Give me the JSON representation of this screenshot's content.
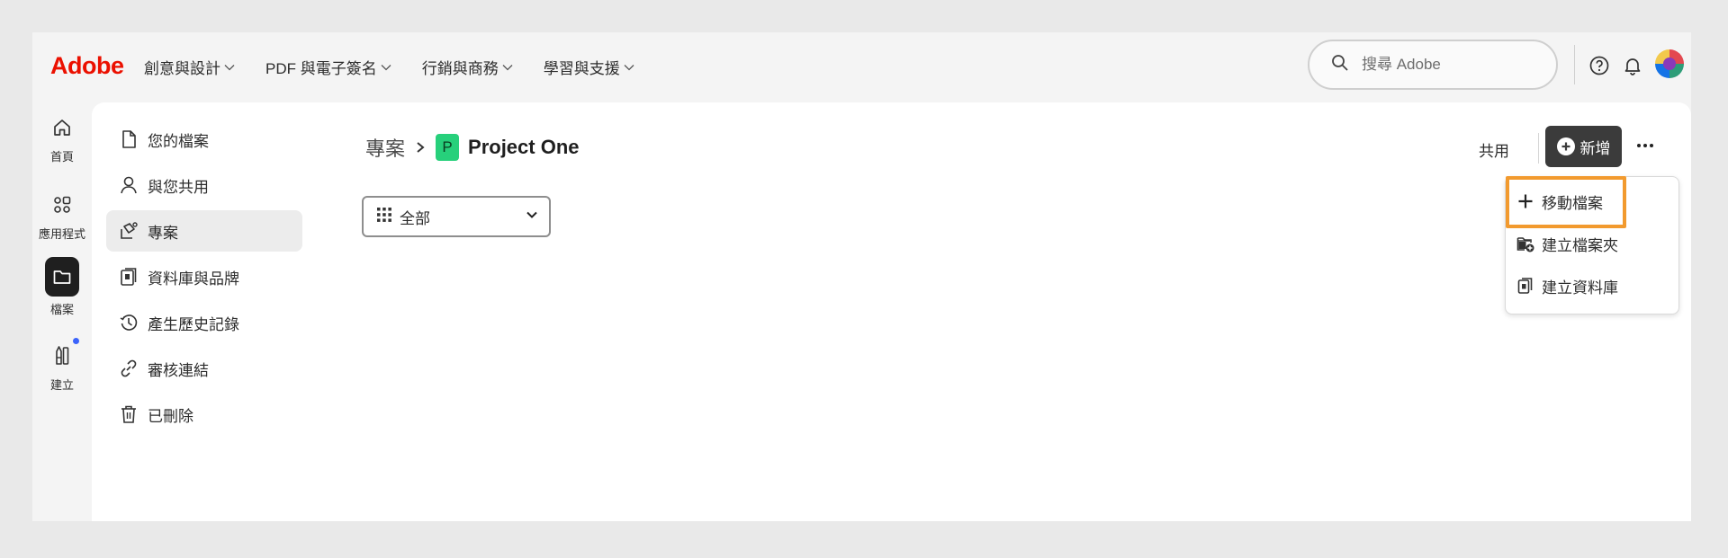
{
  "brand": {
    "logo_text": "Adobe",
    "logo_color": "#eb1000"
  },
  "nav": {
    "items": [
      {
        "label": "創意與設計"
      },
      {
        "label": "PDF 與電子簽名"
      },
      {
        "label": "行銷與商務"
      },
      {
        "label": "學習與支援"
      }
    ]
  },
  "search": {
    "placeholder": "搜尋 Adobe",
    "icon": "search-icon"
  },
  "header_icons": {
    "help": "help-icon",
    "notifications": "bell-icon",
    "avatar": "avatar"
  },
  "rail": {
    "items": [
      {
        "label": "首頁",
        "icon": "home-icon"
      },
      {
        "label": "應用程式",
        "icon": "apps-icon"
      },
      {
        "label": "檔案",
        "icon": "folder-icon",
        "active": true
      },
      {
        "label": "建立",
        "icon": "create-icon",
        "has_dot": true
      }
    ]
  },
  "sidebar": {
    "items": [
      {
        "label": "您的檔案",
        "icon": "file-icon"
      },
      {
        "label": "與您共用",
        "icon": "shared-user-icon"
      },
      {
        "label": "專案",
        "icon": "project-icon",
        "active": true
      },
      {
        "label": "資料庫與品牌",
        "icon": "library-icon"
      },
      {
        "label": "產生歷史記錄",
        "icon": "history-icon"
      },
      {
        "label": "審核連結",
        "icon": "link-icon"
      },
      {
        "label": "已刪除",
        "icon": "trash-icon"
      }
    ]
  },
  "breadcrumb": {
    "root": "專案",
    "badge_letter": "P",
    "badge_color": "#27d07b",
    "title": "Project One"
  },
  "filter": {
    "selected": "全部"
  },
  "toolbar": {
    "share_label": "共用",
    "new_label": "新增"
  },
  "menu": {
    "items": [
      {
        "label": "移動檔案",
        "icon": "plus-icon",
        "highlighted": true
      },
      {
        "label": "建立檔案夾",
        "icon": "new-folder-icon"
      },
      {
        "label": "建立資料庫",
        "icon": "library-icon"
      }
    ],
    "highlight_color": "#f29a2e"
  }
}
